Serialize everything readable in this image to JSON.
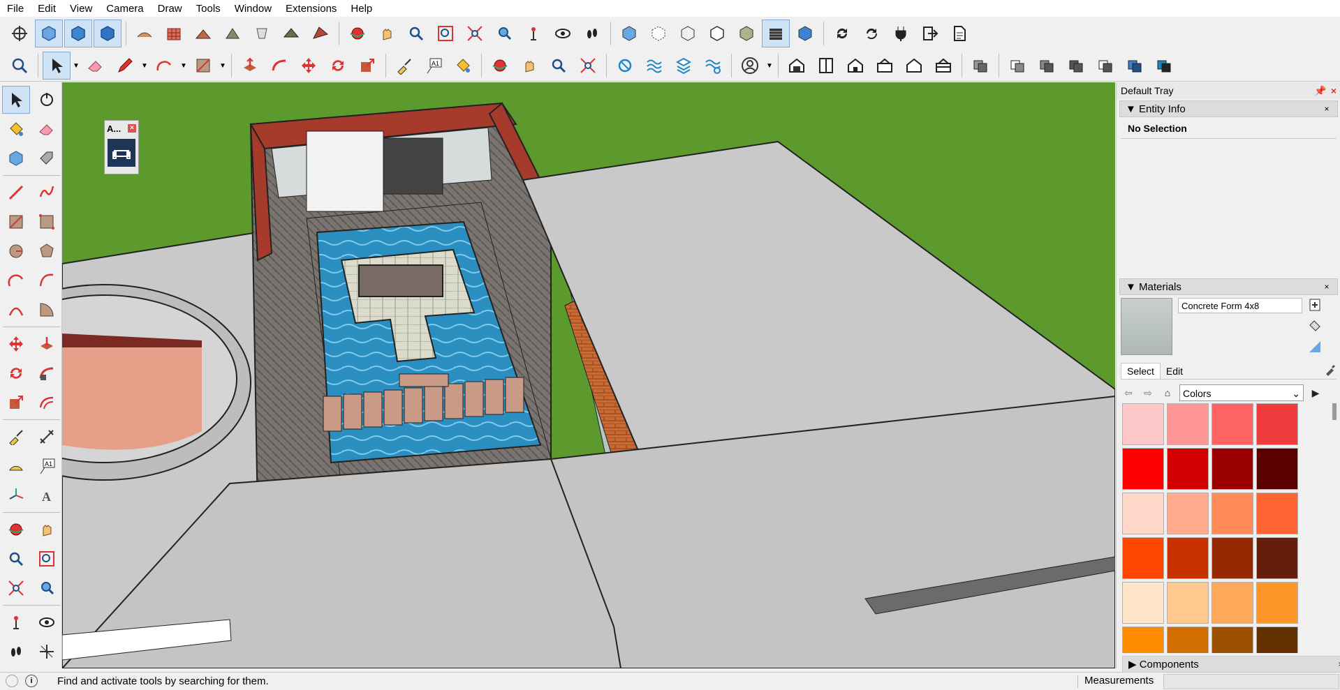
{
  "menu": [
    "File",
    "Edit",
    "View",
    "Camera",
    "Draw",
    "Tools",
    "Window",
    "Extensions",
    "Help"
  ],
  "floating_panel": {
    "title": "A..."
  },
  "tray": {
    "title": "Default Tray",
    "entity_info": {
      "title": "Entity Info",
      "selection": "No Selection"
    },
    "materials": {
      "title": "Materials",
      "name": "Concrete Form 4x8",
      "tabs": [
        "Select",
        "Edit"
      ],
      "library": "Colors",
      "swatches": [
        "#ffc8c8",
        "#ff9696",
        "#ff6464",
        "#f03c3c",
        "#ff0000",
        "#d20000",
        "#9a0000",
        "#5a0000",
        "#ffd7c8",
        "#ffaa8c",
        "#ff8c5a",
        "#ff6432",
        "#ff4600",
        "#c83200",
        "#962800",
        "#641e0a",
        "#ffe6c8",
        "#ffc88c",
        "#ffaa5a",
        "#ff9628",
        "#ff8c00",
        "#d26e00",
        "#9a5000",
        "#643200"
      ]
    },
    "components": {
      "title": "Components"
    }
  },
  "status": {
    "hint": "Find and activate tools by searching for them.",
    "measurements_label": "Measurements",
    "measurements_value": ""
  },
  "colors": {
    "sky_grass": "#5c9a2e",
    "roof": "#a63b2b",
    "water": "#2a8fc0",
    "slab": "#c9c9c9"
  }
}
